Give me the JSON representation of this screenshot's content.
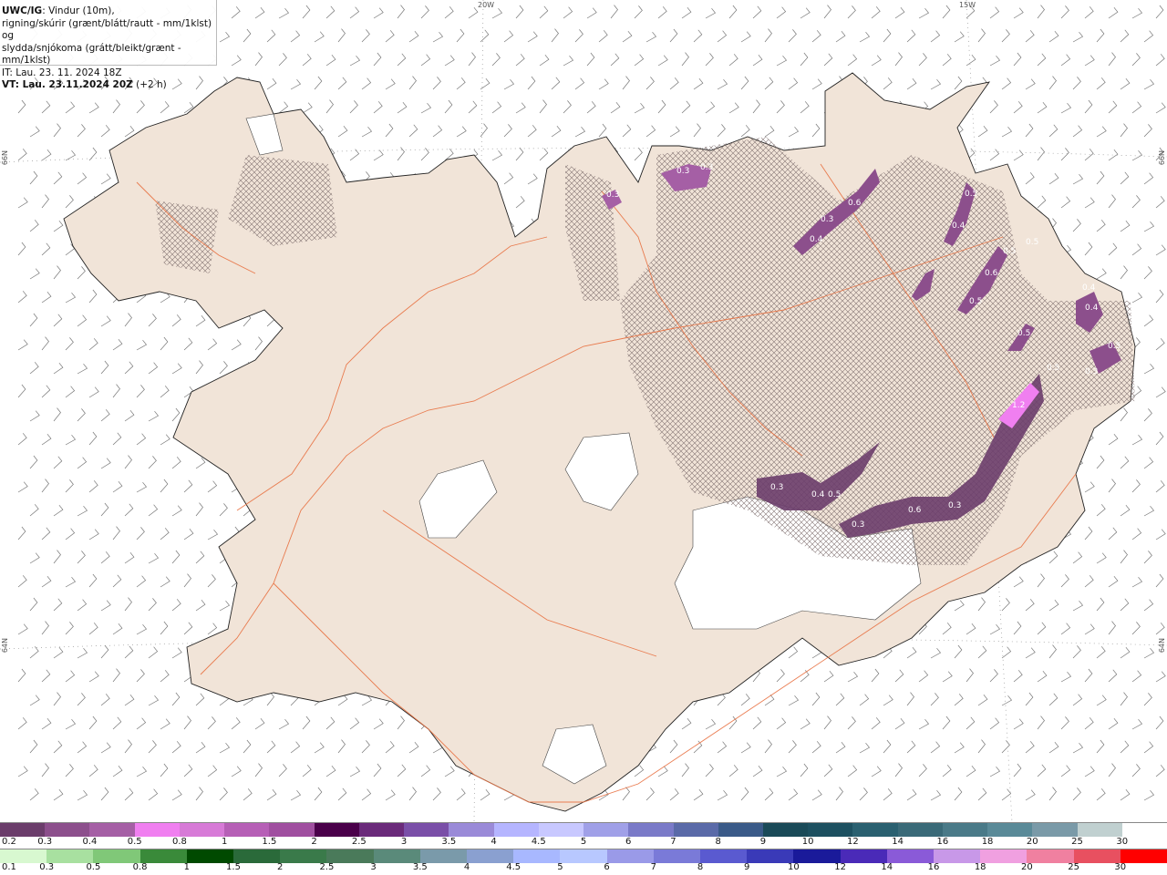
{
  "header": {
    "title": "UWC/IG",
    "line1_rest": ": Vindur (10m),",
    "line2": "rigning/skúrir (grænt/blátt/rautt - mm/1klst) og",
    "line3": "slydda/snjókoma (grátt/bleikt/grænt - mm/1klst)",
    "line4": "IT: Lau. 23. 11. 2024 18Z",
    "line5_bold": "VT: Lau. 23.11.2024 20Z",
    "line5_rest": " (+2 h)"
  },
  "graticule": {
    "top": [
      "20W",
      "15W"
    ],
    "left": [
      "66N",
      "64N"
    ],
    "right": [
      "66N",
      "64N"
    ]
  },
  "precip_labels": [
    "0.3",
    "0.3",
    "0.3",
    "0.6",
    "0.5",
    "0.4",
    "0.3",
    "0.4",
    "0.5",
    "0.5",
    "0.6",
    "0.5",
    "0.4",
    "0.4",
    "0.5",
    "0.5",
    "1.2",
    "0.5",
    "0.3",
    "0.4",
    "0.5",
    "0.6",
    "0.3",
    "0.3",
    "0.3"
  ],
  "legend_snow": {
    "labels": [
      "0.2",
      "0.3",
      "0.4",
      "0.5",
      "0.8",
      "1",
      "1.5",
      "2",
      "2.5",
      "3",
      "3.5",
      "4",
      "4.5",
      "5",
      "6",
      "7",
      "8",
      "9",
      "10",
      "12",
      "14",
      "16",
      "18",
      "20",
      "25",
      "30"
    ],
    "colors": [
      "#6b3d6b",
      "#8c4f8c",
      "#a55fa5",
      "#f07ff0",
      "#d77ad7",
      "#b65fb6",
      "#a04fa0",
      "#4a004a",
      "#6a2a7a",
      "#7a4fa8",
      "#9a8ad8",
      "#b5b5ff",
      "#c8c8ff",
      "#a0a0e8",
      "#7a7ac8",
      "#5a6aa8",
      "#3a5a88",
      "#1a4a58",
      "#1d5060",
      "#2a6070",
      "#3a6a78",
      "#4a7a88",
      "#5a8a98",
      "#7a9aa8",
      "#c0d0d0",
      "#ffffff"
    ]
  },
  "legend_rain": {
    "labels": [
      "0.1",
      "0.3",
      "0.5",
      "0.8",
      "1",
      "1.5",
      "2",
      "2.5",
      "3",
      "3.5",
      "4",
      "4.5",
      "5",
      "6",
      "7",
      "8",
      "9",
      "10",
      "12",
      "14",
      "16",
      "18",
      "20",
      "25",
      "30"
    ],
    "colors": [
      "#d8f8d0",
      "#a8e0a0",
      "#80c878",
      "#3a8a3a",
      "#004a00",
      "#2a6a3a",
      "#3a7a4a",
      "#4a7a5a",
      "#5a8a7a",
      "#7a9aaa",
      "#8aa0d0",
      "#a8b8ff",
      "#b8c8ff",
      "#9a9ae8",
      "#7a7ad8",
      "#5a5ad0",
      "#3a3ab8",
      "#1a1a9a",
      "#4a2ab8",
      "#8a5ad8",
      "#c898e8",
      "#f0a0e0",
      "#f080a0",
      "#e85060",
      "#ff0000"
    ]
  }
}
